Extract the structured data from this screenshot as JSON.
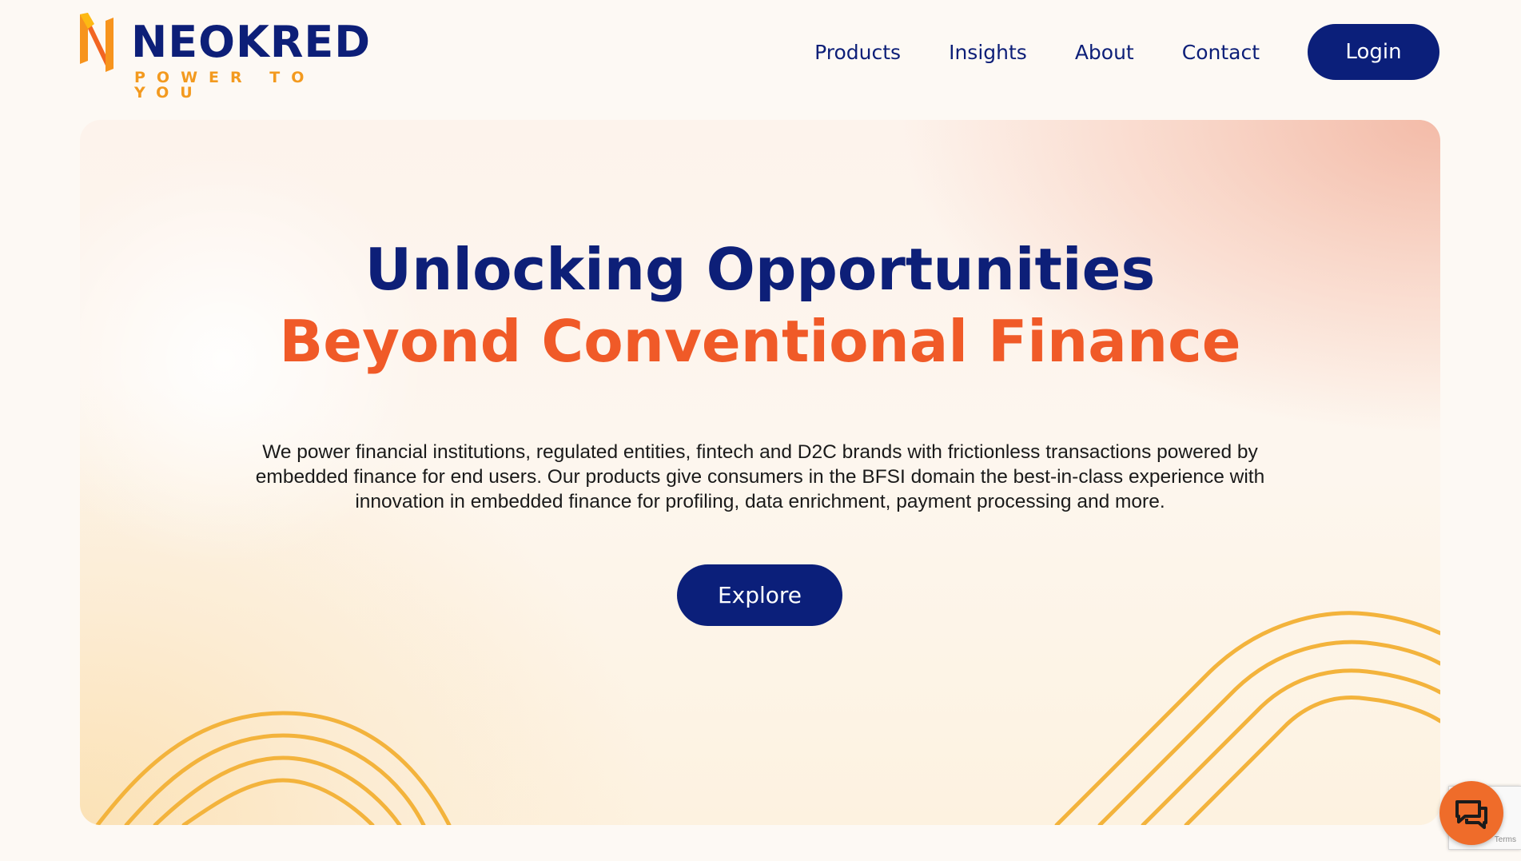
{
  "brand": {
    "name": "NEOKRED",
    "tagline": "POWER TO YOU"
  },
  "nav": {
    "items": [
      "Products",
      "Insights",
      "About",
      "Contact"
    ],
    "login_label": "Login"
  },
  "hero": {
    "title_line1": "Unlocking Opportunities",
    "title_line2": "Beyond Conventional Finance",
    "description": "We power financial institutions, regulated entities, fintech and D2C brands with frictionless transactions powered by embedded finance for end users. Our products give consumers in the BFSI domain the best-in-class experience with innovation in embedded finance for profiling, data enrichment, payment processing and more.",
    "cta_label": "Explore"
  },
  "recaptcha": {
    "text": "Terms"
  },
  "colors": {
    "navy": "#0b1f7a",
    "orange": "#f05a28",
    "amber": "#f3b33c"
  },
  "icons": {
    "logo": "neokred-logo-icon",
    "chat": "chat-bubbles-icon"
  }
}
